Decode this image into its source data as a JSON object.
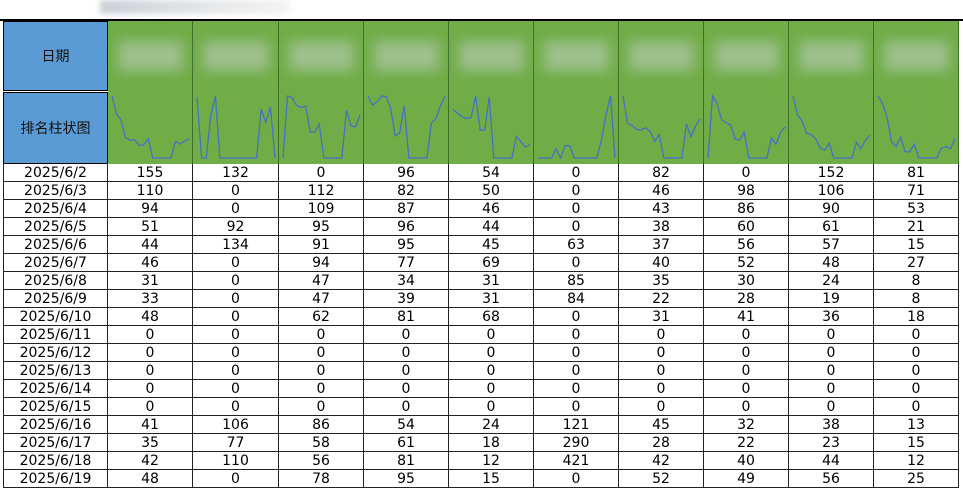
{
  "header": {
    "date_label": "日期",
    "chart_label": "排名柱状图"
  },
  "colors": {
    "header_blue": "#5b9bd5",
    "header_green": "#70ad47",
    "spark_line": "#4472c4"
  },
  "rows": [
    {
      "date": "2025/6/2",
      "values": [
        "155",
        "132",
        "0",
        "96",
        "54",
        "0",
        "82",
        "0",
        "152",
        "81"
      ]
    },
    {
      "date": "2025/6/3",
      "values": [
        "110",
        "0",
        "112",
        "82",
        "50",
        "0",
        "46",
        "98",
        "106",
        "71"
      ]
    },
    {
      "date": "2025/6/4",
      "values": [
        "94",
        "0",
        "109",
        "87",
        "46",
        "0",
        "43",
        "86",
        "90",
        "53"
      ]
    },
    {
      "date": "2025/6/5",
      "values": [
        "51",
        "92",
        "95",
        "96",
        "44",
        "0",
        "38",
        "60",
        "61",
        "21"
      ]
    },
    {
      "date": "2025/6/6",
      "values": [
        "44",
        "134",
        "91",
        "95",
        "45",
        "63",
        "37",
        "56",
        "57",
        "15"
      ]
    },
    {
      "date": "2025/6/7",
      "values": [
        "46",
        "0",
        "94",
        "77",
        "69",
        "0",
        "40",
        "52",
        "48",
        "27"
      ]
    },
    {
      "date": "2025/6/8",
      "values": [
        "31",
        "0",
        "47",
        "34",
        "31",
        "85",
        "35",
        "30",
        "24",
        "8"
      ]
    },
    {
      "date": "2025/6/9",
      "values": [
        "33",
        "0",
        "47",
        "39",
        "31",
        "84",
        "22",
        "28",
        "19",
        "8"
      ]
    },
    {
      "date": "2025/6/10",
      "values": [
        "48",
        "0",
        "62",
        "81",
        "68",
        "0",
        "31",
        "41",
        "36",
        "18"
      ]
    },
    {
      "date": "2025/6/11",
      "values": [
        "0",
        "0",
        "0",
        "0",
        "0",
        "0",
        "0",
        "0",
        "0",
        "0"
      ]
    },
    {
      "date": "2025/6/12",
      "values": [
        "0",
        "0",
        "0",
        "0",
        "0",
        "0",
        "0",
        "0",
        "0",
        "0"
      ]
    },
    {
      "date": "2025/6/13",
      "values": [
        "0",
        "0",
        "0",
        "0",
        "0",
        "0",
        "0",
        "0",
        "0",
        "0"
      ]
    },
    {
      "date": "2025/6/14",
      "values": [
        "0",
        "0",
        "0",
        "0",
        "0",
        "0",
        "0",
        "0",
        "0",
        "0"
      ]
    },
    {
      "date": "2025/6/15",
      "values": [
        "0",
        "0",
        "0",
        "0",
        "0",
        "0",
        "0",
        "0",
        "0",
        "0"
      ]
    },
    {
      "date": "2025/6/16",
      "values": [
        "41",
        "106",
        "86",
        "54",
        "24",
        "121",
        "45",
        "32",
        "38",
        "13"
      ]
    },
    {
      "date": "2025/6/17",
      "values": [
        "35",
        "77",
        "58",
        "61",
        "18",
        "290",
        "28",
        "22",
        "23",
        "15"
      ]
    },
    {
      "date": "2025/6/18",
      "values": [
        "42",
        "110",
        "56",
        "81",
        "12",
        "421",
        "42",
        "40",
        "44",
        "12"
      ]
    },
    {
      "date": "2025/6/19",
      "values": [
        "48",
        "0",
        "78",
        "95",
        "15",
        "0",
        "52",
        "49",
        "56",
        "25"
      ]
    }
  ]
}
